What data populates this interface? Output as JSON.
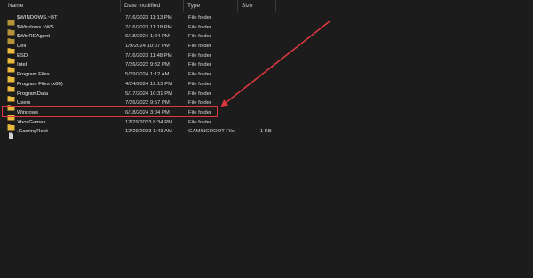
{
  "columns": {
    "name": "Name",
    "date_modified": "Date modified",
    "type": "Type",
    "size": "Size"
  },
  "files": [
    {
      "name": "$WINDOWS.~BT",
      "date": "7/16/2023 11:13 PM",
      "type": "File folder",
      "size": "",
      "icon": "folder-icon"
    },
    {
      "name": "$Windows.~WS",
      "date": "7/16/2023 11:18 PM",
      "type": "File folder",
      "size": "",
      "icon": "folder-icon"
    },
    {
      "name": "$WinREAgent",
      "date": "6/18/2024 1:24 PM",
      "type": "File folder",
      "size": "",
      "icon": "folder-icon"
    },
    {
      "name": "Dell",
      "date": "1/9/2024 10:07 PM",
      "type": "File folder",
      "size": "",
      "icon": "folder-icon"
    },
    {
      "name": "ESD",
      "date": "7/16/2023 11:48 PM",
      "type": "File folder",
      "size": "",
      "icon": "folder-icon"
    },
    {
      "name": "Intel",
      "date": "7/26/2022 9:32 PM",
      "type": "File folder",
      "size": "",
      "icon": "folder-icon"
    },
    {
      "name": "Program Files",
      "date": "5/29/2024 1:12 AM",
      "type": "File folder",
      "size": "",
      "icon": "folder-icon"
    },
    {
      "name": "Program Files (x86)",
      "date": "4/24/2024 12:13 PM",
      "type": "File folder",
      "size": "",
      "icon": "folder-icon"
    },
    {
      "name": "ProgramData",
      "date": "5/17/2024 10:31 PM",
      "type": "File folder",
      "size": "",
      "icon": "folder-icon"
    },
    {
      "name": "Users",
      "date": "7/26/2022 9:57 PM",
      "type": "File folder",
      "size": "",
      "icon": "folder-icon"
    },
    {
      "name": "Windows",
      "date": "6/18/2024 3:04 PM",
      "type": "File folder",
      "size": "",
      "icon": "folder-icon"
    },
    {
      "name": "XboxGames",
      "date": "12/29/2023 8:34 PM",
      "type": "File folder",
      "size": "",
      "icon": "folder-icon"
    },
    {
      "name": ".GamingRoot",
      "date": "12/29/2023 1:43 AM",
      "type": "GAMINGROOT File",
      "size": "1 KB",
      "icon": "file-icon"
    }
  ],
  "annotation": {
    "color": "#d9383e",
    "highlighted_item": "Windows"
  },
  "colors": {
    "background": "#1c1c1c",
    "folder": "#e8b93c",
    "folder_dim": "#b5923a",
    "text": "#e8e8e8"
  }
}
